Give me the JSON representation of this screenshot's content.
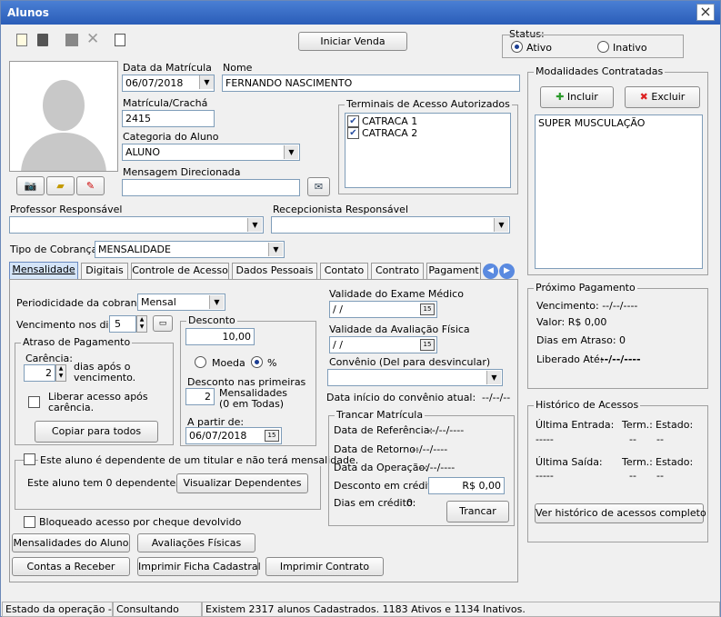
{
  "window": {
    "title": "Alunos",
    "close": "×"
  },
  "toolbar": {
    "iniciar_venda": "Iniciar Venda"
  },
  "status": {
    "title": "Status:",
    "ativo": "Ativo",
    "inativo": "Inativo",
    "selected": "Ativo"
  },
  "aluno": {
    "data_matricula_label": "Data da Matrícula",
    "data_matricula": "06/07/2018",
    "nome_label": "Nome",
    "nome": "FERNANDO NASCIMENTO",
    "matricula_label": "Matrícula/Crachá",
    "matricula": "2415",
    "categoria_label": "Categoria do Aluno",
    "categoria": "ALUNO",
    "mensagem_label": "Mensagem Direcionada",
    "mensagem": "",
    "professor_label": "Professor Responsável",
    "professor": "",
    "recepcionista_label": "Recepcionista Responsável",
    "recepcionista": "",
    "tipo_cobranca_label": "Tipo de Cobrança:",
    "tipo_cobranca": "MENSALIDADE"
  },
  "terminais": {
    "title": "Terminais de Acesso Autorizados",
    "items": [
      "CATRACA 1",
      "CATRACA 2"
    ]
  },
  "modalidades": {
    "title": "Modalidades Contratadas",
    "incluir": "Incluir",
    "excluir": "Excluir",
    "items": [
      "SUPER MUSCULAÇÃO"
    ]
  },
  "tabs": [
    "Mensalidade",
    "Digitais",
    "Controle de Acesso",
    "Dados Pessoais",
    "Contato",
    "Contrato",
    "Pagament"
  ],
  "mensalidade": {
    "periodicidade_label": "Periodicidade da cobrança:",
    "periodicidade": "Mensal",
    "vencimento_label": "Vencimento nos dias:",
    "vencimento": "5",
    "atraso_title": "Atraso de Pagamento",
    "carencia_label": "Carência:",
    "carencia": "2",
    "carencia_suffix": "dias após o vencimento.",
    "liberar_label": "Liberar acesso após carência.",
    "copiar": "Copiar para todos",
    "desconto_title": "Desconto",
    "desconto_valor": "10,00",
    "moeda": "Moeda",
    "percent": "%",
    "desc_primeiras_label": "Desconto nas primeiras",
    "desc_primeiras": "2",
    "desc_mensalidades": "Mensalidades",
    "desc_em_todas": "(0 em Todas)",
    "a_partir_label": "A partir de:",
    "a_partir": "06/07/2018",
    "dependente_label": "Este aluno é dependente de um titular e não terá mensalidade.",
    "dependentes_text": "Este aluno tem 0 dependentes.",
    "visualizar": "Visualizar Dependentes",
    "bloqueado_label": "Bloqueado acesso por cheque devolvido",
    "validade_exame_label": "Validade do Exame Médico",
    "validade_exame": " /  /",
    "validade_aval_label": "Validade da Avaliação Física",
    "validade_aval": " /  /",
    "convenio_label": "Convênio (Del para desvincular)",
    "convenio": "",
    "data_inicio_label": "Data início do convênio atual:",
    "data_inicio": "--/--/--",
    "trancar_title": "Trancar Matrícula",
    "data_ref_label": "Data de Referência:",
    "data_ref": "--/--/----",
    "data_ret_label": "Data de Retorno:",
    "data_ret": "--/--/----",
    "data_op_label": "Data da Operação:",
    "data_op": "--/--/----",
    "desc_credito_label": "Desconto em crédito:",
    "desc_credito": "R$ 0,00",
    "dias_credito_label": "Dias em crédito:",
    "dias_credito": "0",
    "trancar": "Trancar"
  },
  "bottom_buttons": {
    "mensalidades": "Mensalidades do Aluno",
    "avaliacoes": "Avaliações Físicas",
    "contas": "Contas a Receber",
    "ficha": "Imprimir Ficha Cadastral",
    "contrato": "Imprimir Contrato"
  },
  "pagamento": {
    "title": "Próximo Pagamento",
    "vencimento": "Vencimento:  --/--/----",
    "valor": "Valor:  R$ 0,00",
    "dias_atraso": "Dias em Atraso:  0",
    "liberado_label": "Liberado Até:",
    "liberado": "--/--/----"
  },
  "historico": {
    "title": "Histórico de Acessos",
    "ultima_entrada": "Última Entrada:",
    "ultima_saida": "Última Saída:",
    "term": "Term.:",
    "estado": "Estado:",
    "dash_date": "-----",
    "dash": "--",
    "ver": "Ver histórico de acessos completo"
  },
  "statusbar": {
    "estado": "Estado da operação ->",
    "modo": "Consultando",
    "info": "Existem 2317 alunos Cadastrados. 1183 Ativos e 1134 Inativos."
  }
}
